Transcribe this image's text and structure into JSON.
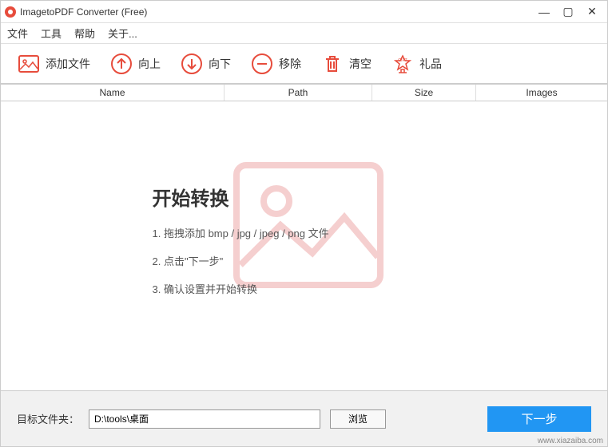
{
  "window": {
    "title": "ImagetoPDF Converter (Free)"
  },
  "menubar": {
    "file": "文件",
    "tools": "工具",
    "help": "帮助",
    "about": "关于..."
  },
  "toolbar": {
    "add_file": "添加文件",
    "move_up": "向上",
    "move_down": "向下",
    "remove": "移除",
    "clear": "清空",
    "gift": "礼品"
  },
  "table": {
    "headers": {
      "name": "Name",
      "path": "Path",
      "size": "Size",
      "images": "Images"
    }
  },
  "instructions": {
    "title": "开始转换",
    "step1": "1. 拖拽添加 bmp / jpg / jpeg / png 文件",
    "step2": "2. 点击\"下一步\"",
    "step3": "3. 确认设置并开始转换"
  },
  "footer": {
    "target_label": "目标文件夹：",
    "path_value": "D:\\tools\\桌面",
    "browse": "浏览",
    "next": "下一步"
  },
  "watermark": "www.xiazaiba.com"
}
